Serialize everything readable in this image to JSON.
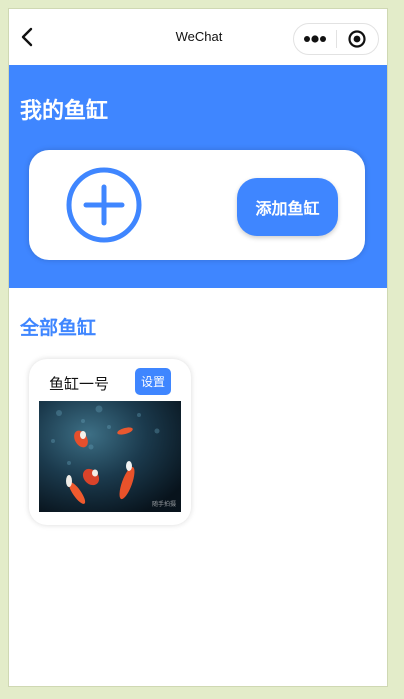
{
  "navbar": {
    "title": "WeChat",
    "back_icon": "chevron-left-icon",
    "more_icon": "more-dots-icon",
    "close_icon": "target-circle-icon"
  },
  "hero": {
    "title": "我的鱼缸",
    "add_icon": "plus-circle-icon",
    "add_button_label": "添加鱼缸"
  },
  "section": {
    "title": "全部鱼缸"
  },
  "tanks": [
    {
      "name": "鱼缸一号",
      "settings_label": "设置",
      "photo_watermark": "随手拍摄"
    }
  ],
  "colors": {
    "accent": "#3f86ff",
    "background": "#ffffff",
    "frame": "#e3ecc9"
  }
}
